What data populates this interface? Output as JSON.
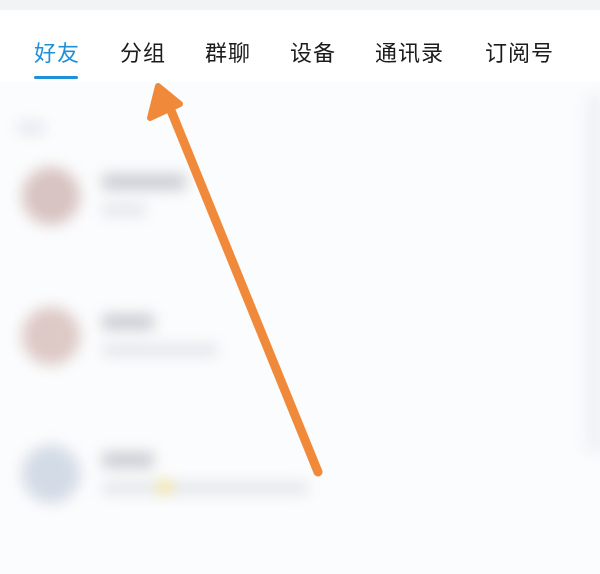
{
  "tabs": [
    {
      "label": "好友",
      "active": true
    },
    {
      "label": "分组",
      "active": false
    },
    {
      "label": "群聊",
      "active": false
    },
    {
      "label": "设备",
      "active": false
    },
    {
      "label": "通讯录",
      "active": false
    },
    {
      "label": "订阅号",
      "active": false
    }
  ],
  "colors": {
    "active_tab": "#1f8fd6",
    "annotation_arrow": "#f08a3a"
  },
  "annotation": {
    "icon": "arrow-annotation-icon"
  }
}
